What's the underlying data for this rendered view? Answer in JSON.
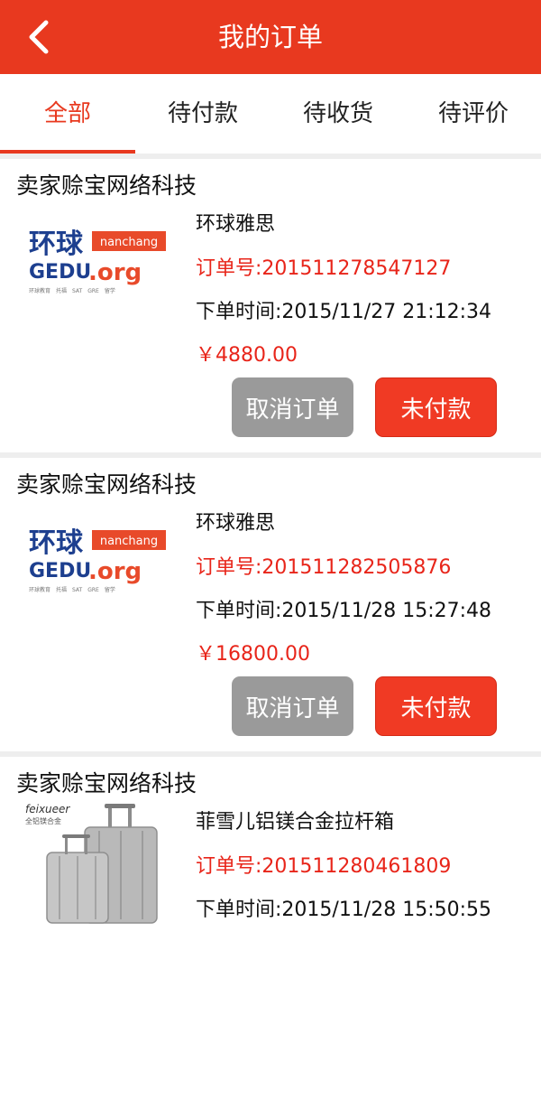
{
  "header": {
    "title": "我的订单"
  },
  "tabs": [
    "全部",
    "待付款",
    "待收货",
    "待评价"
  ],
  "logo": {
    "cn": "环球",
    "badge": "nanchang",
    "en_left": "GEDU",
    "en_right": ".org",
    "tagline": "环球教育　托福　SAT　GRE　留学"
  },
  "suitcase_logo": {
    "brand": "feixueer",
    "sub": "全铝镁合金"
  },
  "orders": [
    {
      "seller": "卖家赊宝网络科技",
      "product": "环球雅思",
      "order_no": "订单号:201511278547127",
      "time": "下单时间:2015/11/27 21:12:34",
      "price": "￥4880.00",
      "cancel": "取消订单",
      "status": "未付款"
    },
    {
      "seller": "卖家赊宝网络科技",
      "product": "环球雅思",
      "order_no": "订单号:201511282505876",
      "time": "下单时间:2015/11/28 15:27:48",
      "price": "￥16800.00",
      "cancel": "取消订单",
      "status": "未付款"
    },
    {
      "seller": "卖家赊宝网络科技",
      "product": "菲雪儿铝镁合金拉杆箱",
      "order_no": "订单号:201511280461809",
      "time": "下单时间:2015/11/28 15:50:55"
    }
  ],
  "colors": {
    "accent": "#e8391f",
    "price": "#e8251a",
    "cancel_btn": "#9a9a9a"
  }
}
